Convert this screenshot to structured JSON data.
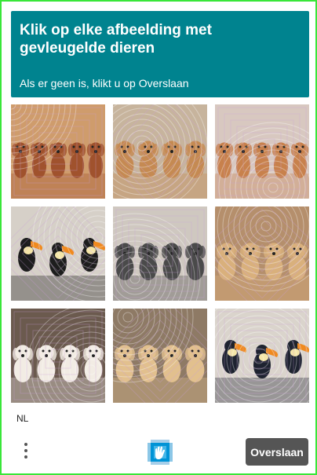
{
  "challenge": {
    "title": "Klik op elke afbeelding met gevleugelde dieren",
    "subtitle": "Als er geen is, klikt u op Overslaan"
  },
  "tiles": [
    {
      "subject": "puppies",
      "bg": "#cf9c6c",
      "fg": "#a0522d",
      "count": 5
    },
    {
      "subject": "puppies",
      "bg": "#c7b49d",
      "fg": "#c58a52",
      "count": 4
    },
    {
      "subject": "puppies",
      "bg": "#d8c8c0",
      "fg": "#c8814c",
      "count": 5
    },
    {
      "subject": "toucans",
      "bg": "#d6d0c8",
      "fg": "#1d1d1d",
      "count": 3
    },
    {
      "subject": "puppies",
      "bg": "#cfc8c0",
      "fg": "#4a4a4a",
      "count": 4
    },
    {
      "subject": "puppies",
      "bg": "#b58f6c",
      "fg": "#d9b07c",
      "count": 4
    },
    {
      "subject": "puppies",
      "bg": "#6b5a4e",
      "fg": "#f2ece4",
      "count": 4
    },
    {
      "subject": "puppies",
      "bg": "#8e7a65",
      "fg": "#e2c08e",
      "count": 4
    },
    {
      "subject": "toucans",
      "bg": "#dad4cc",
      "fg": "#1e2330",
      "count": 3
    }
  ],
  "footer": {
    "language": "NL",
    "skip_label": "Overslaan"
  },
  "colors": {
    "accent": "#00838f",
    "skip_button": "#555555",
    "frame_border": "#39e639"
  }
}
